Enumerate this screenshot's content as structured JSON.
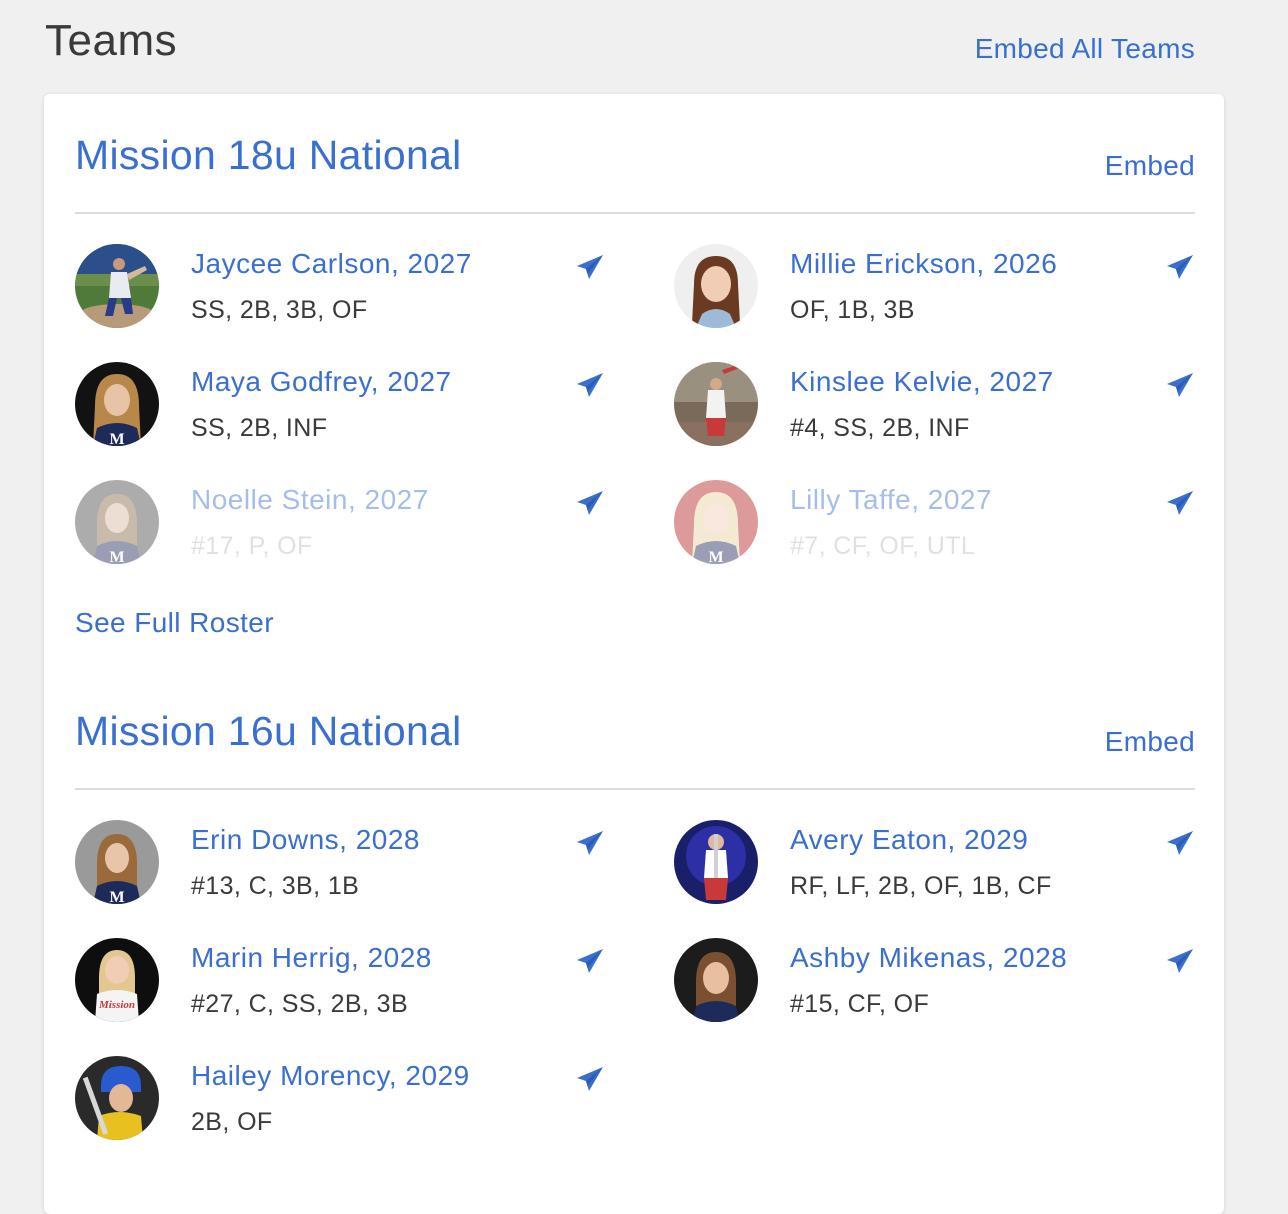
{
  "header": {
    "title": "Teams",
    "embed_all_label": "Embed All Teams"
  },
  "colors": {
    "accent": "#3a6fd0",
    "text": "#3a3a3a",
    "background": "#f0f0f0",
    "card": "#ffffff"
  },
  "teams": [
    {
      "name": "Mission 18u National",
      "embed_label": "Embed",
      "see_full_label": "See Full Roster",
      "players": [
        {
          "name": "Jaycee Carlson, 2027",
          "positions": "SS, 2B, 3B, OF",
          "icon": "paper-plane-icon"
        },
        {
          "name": "Millie Erickson, 2026",
          "positions": "OF, 1B, 3B",
          "icon": "paper-plane-icon"
        },
        {
          "name": "Maya Godfrey, 2027",
          "positions": "SS, 2B, INF",
          "icon": "paper-plane-icon"
        },
        {
          "name": "Kinslee Kelvie, 2027",
          "positions": "#4, SS, 2B, INF",
          "icon": "paper-plane-icon"
        },
        {
          "name": "Noelle Stein, 2027",
          "positions": "#17, P, OF",
          "icon": "paper-plane-icon"
        },
        {
          "name": "Lilly Taffe, 2027",
          "positions": "#7, CF, OF, UTL",
          "icon": "paper-plane-icon"
        }
      ]
    },
    {
      "name": "Mission 16u National",
      "embed_label": "Embed",
      "players": [
        {
          "name": "Erin Downs, 2028",
          "positions": "#13, C, 3B, 1B",
          "icon": "paper-plane-icon"
        },
        {
          "name": "Avery Eaton, 2029",
          "positions": "RF, LF, 2B, OF, 1B, CF",
          "icon": "paper-plane-icon"
        },
        {
          "name": "Marin Herrig, 2028",
          "positions": "#27, C, SS, 2B, 3B",
          "icon": "paper-plane-icon"
        },
        {
          "name": "Ashby Mikenas, 2028",
          "positions": "#15, CF, OF",
          "icon": "paper-plane-icon"
        },
        {
          "name": "Hailey Morency, 2029",
          "positions": "2B, OF",
          "icon": "paper-plane-icon"
        }
      ]
    }
  ]
}
